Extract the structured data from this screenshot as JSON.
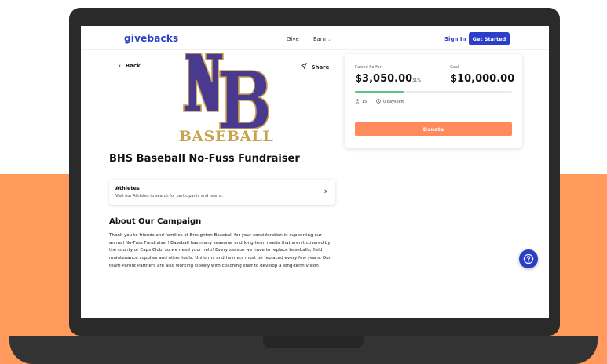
{
  "header": {
    "logo": "givebacks",
    "nav": {
      "give": "Give",
      "earn": "Earn"
    },
    "sign_in": "Sign In",
    "get_started": "Get Started"
  },
  "page": {
    "back": "Back",
    "share": "Share",
    "team_logo": {
      "monogram": "NB",
      "wordmark": "BASEBALL"
    },
    "title": "BHS Baseball No-Fuss Fundraiser",
    "athletes": {
      "title": "Athletes",
      "subtitle": "Visit our Athletes to search for participants and teams."
    },
    "about_title": "About Our Campaign",
    "about_text": "Thank you to friends and families of Broughton Baseball for your consideration in supporting our annual No-Fuss Fundraiser! Baseball has many seasonal and long-term needs that aren't covered by the county or Caps Club, so we need your help! Every season we have to replace baseballs, field maintenance supplies and other tools. Uniforms and helmets must be replaced every few years. Our team Parent Partners are also working closely with coaching staff to develop a long-term vision"
  },
  "campaign": {
    "raised_label": "Raised So Far",
    "raised_amount": "$3,050.00",
    "percent": "31%",
    "progress_fraction": 0.31,
    "goal_label": "Goal",
    "goal_amount": "$10,000.00",
    "donors": "15",
    "days_left": "0 days left",
    "donate": "Donate"
  },
  "colors": {
    "brand": "#2c3ec7",
    "donate": "#FF8A5B",
    "progress": "#5cc28a",
    "background_band": "#FF9A5C",
    "logo_purple": "#4a3a8f",
    "logo_gold": "#c9a24e"
  },
  "icons": {
    "back": "arrow-left-icon",
    "share": "send-icon",
    "athletes": "chevron-right-icon",
    "donors": "person-icon",
    "days": "clock-icon",
    "help": "question-circle-icon"
  }
}
